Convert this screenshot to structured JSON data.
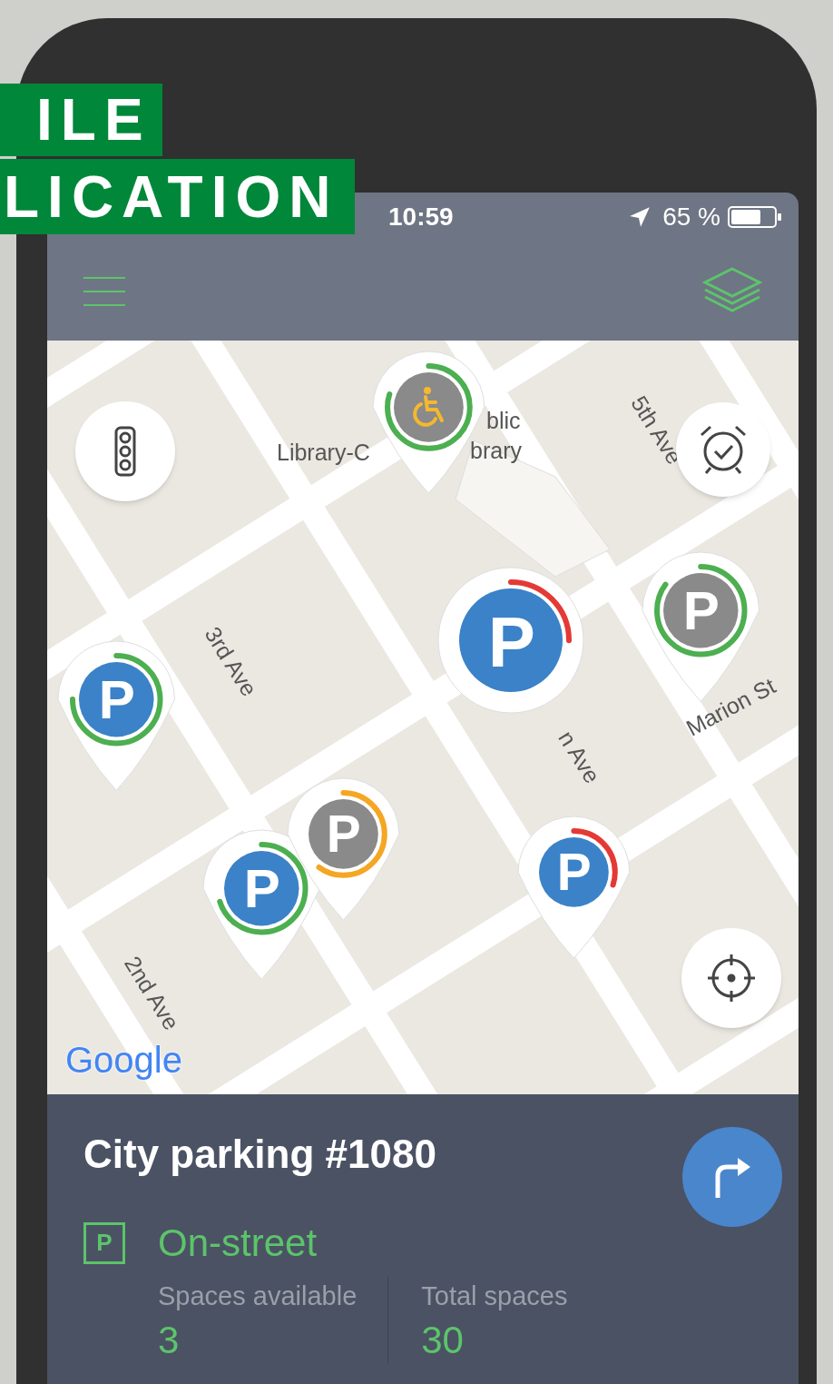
{
  "banner": {
    "lines": [
      "ILE",
      "LICATION"
    ]
  },
  "status_bar": {
    "time": "10:59",
    "battery": "65 %"
  },
  "map": {
    "labels": [
      {
        "text": "Library-C"
      },
      {
        "text": "blic"
      },
      {
        "text": "brary"
      },
      {
        "text": "5th Ave"
      },
      {
        "text": "3rd Ave"
      },
      {
        "text": "n Ave"
      },
      {
        "text": "Marion St"
      },
      {
        "text": "2nd Ave"
      }
    ],
    "attribution": "Google",
    "pins": [
      {
        "kind": "accessible",
        "color": "#4caf50",
        "level": 0.8,
        "selected": false
      },
      {
        "kind": "active",
        "label": "P",
        "color": "#e53935",
        "level": 0.25,
        "selected": true
      },
      {
        "kind": "inactive",
        "label": "P",
        "color": "#4caf50",
        "level": 0.85,
        "selected": false
      },
      {
        "kind": "active",
        "label": "P",
        "color": "#4caf50",
        "level": 0.75,
        "selected": false
      },
      {
        "kind": "active",
        "label": "P",
        "color": "#4caf50",
        "level": 0.7,
        "selected": false
      },
      {
        "kind": "inactive",
        "label": "P",
        "color": "#f5a623",
        "level": 0.6,
        "selected": false
      },
      {
        "kind": "active",
        "label": "P",
        "color": "#e53935",
        "level": 0.3,
        "selected": false
      }
    ]
  },
  "details": {
    "title": "City parking #1080",
    "type_icon": "P",
    "type": "On-street",
    "stats": [
      {
        "label": "Spaces available",
        "value": "3"
      },
      {
        "label": "Total spaces",
        "value": "30"
      }
    ]
  }
}
